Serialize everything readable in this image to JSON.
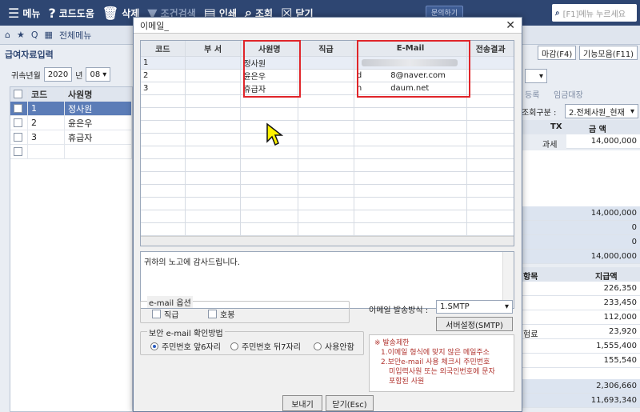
{
  "topbar": {
    "menu": "메뉴",
    "code_help": "코드도움",
    "delete": "삭제",
    "conditional_search": "조건검색",
    "print": "인쇄",
    "inquiry": "조회",
    "close": "닫기",
    "inquiry_btn": "문의하기",
    "search_placeholder": "[F1]메뉴 누르세요"
  },
  "navbar": {
    "all_menu": "전체메뉴"
  },
  "left": {
    "title": "급여자료입력",
    "period_label": "귀속년월",
    "year": "2020",
    "year_unit": "년",
    "month": "08",
    "headers": [
      "코드",
      "사원명"
    ],
    "rows": [
      {
        "code": "1",
        "name": "정사원"
      },
      {
        "code": "2",
        "name": "윤은우"
      },
      {
        "code": "3",
        "name": "휴급자"
      }
    ]
  },
  "right": {
    "btn_deadline": "마감(F4)",
    "btn_features": "기능모음(F11)",
    "tab_register": "등록",
    "tab_wage_ledger": "임금대장",
    "lookup_label": "조회구분 :",
    "lookup_value": "2.전체사원_현재",
    "col_tx": "TX",
    "col_amount": "금 액",
    "taxable": "과세",
    "amount1": "14,000,000",
    "sum1": "14,000,000",
    "zero1": "0",
    "zero2": "0",
    "sum2": "14,000,000",
    "col_item_fragment": "항목",
    "col_paid": "지급액",
    "d1": "226,350",
    "d2": "233,450",
    "d3": "112,000",
    "d4_label": "험료",
    "d4": "23,920",
    "d5": "1,555,400",
    "d6": "155,540",
    "t1": "2,306,660",
    "t2": "11,693,340"
  },
  "dialog": {
    "title": "이메일_",
    "headers": [
      "코드",
      "부 서",
      "사원명",
      "직급",
      "E-Mail",
      "전송결과"
    ],
    "rows": [
      {
        "code": "1",
        "dept": "",
        "name": "정사원",
        "rank": "",
        "email_prefix": "",
        "email": "",
        "result": ""
      },
      {
        "code": "2",
        "dept": "",
        "name": "윤은우",
        "rank": "",
        "email_prefix": "d",
        "email": "8@naver.com",
        "result": ""
      },
      {
        "code": "3",
        "dept": "",
        "name": "휴급자",
        "rank": "",
        "email_prefix": "h",
        "email": "daum.net",
        "result": ""
      }
    ],
    "memo": "귀하의 노고에 감사드립니다.",
    "options_label": "e-mail 옵션",
    "opt_rank": "직급",
    "opt_title": "호봉",
    "method_label": "이메일 발송방식 :",
    "method_value": "1.SMTP",
    "server_btn": "서버설정(SMTP)",
    "secure_label": "보안 e-mail 확인방법",
    "radio1": "주민번호 앞6자리",
    "radio2": "주민번호 뒤7자리",
    "radio3": "사용안함",
    "warn_title": "※ 발송제한",
    "warn1": "1.이메일 형식에 맞지 않은 메일주소",
    "warn2": "2.보안e-mail 사용 체크시 주민번호",
    "warn3": "미입력사원 또는 외국인번호에 문자",
    "warn4": "포함된 사원",
    "send_btn": "보내기",
    "close_btn": "닫기(Esc)"
  },
  "colors": {
    "topbar": "#2e4672",
    "highlight": "#e0252a",
    "selected_row": "#5b7cb7"
  }
}
